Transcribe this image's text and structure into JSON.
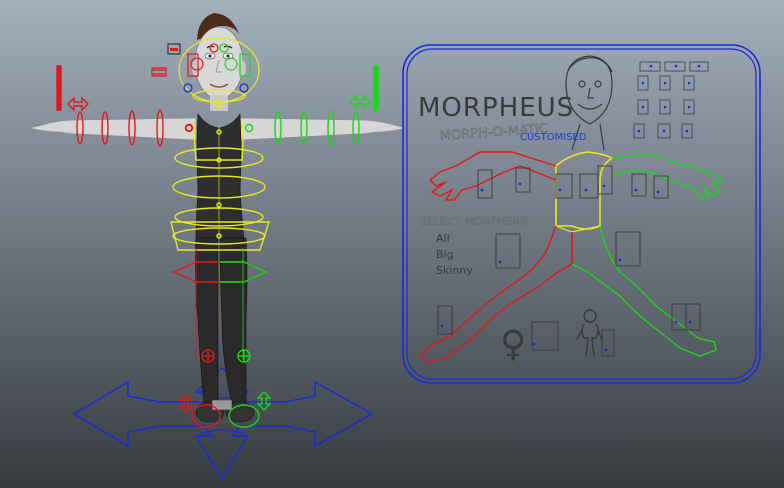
{
  "viewport": {
    "background_top": "#a3afbd",
    "background_bottom": "#373b40"
  },
  "colors": {
    "left_side_control": "#e01818",
    "right_side_control": "#18d818",
    "center_control": "#e8e820",
    "ground_control": "#1a2ad8",
    "panel_border": "#1a2ad8",
    "panel_text": "#3a3a3a",
    "customised_text": "#1a3ad8",
    "skin": "#d8d8d8",
    "body_suit": "#2e2e2e",
    "hair": "#4a2a18"
  },
  "character_rig": {
    "name": "body-rig",
    "ground_control_icon": "four-way-arrow-icon",
    "foot_switch_icons": [
      "updown-arrow-icon",
      "updown-arrow-icon"
    ]
  },
  "morph_panel": {
    "title": "MORPHEUS",
    "subtitle": "MORPH-O-MATIC",
    "tagline": "CUSTOMISED",
    "select_morphers_label": "SELECT MORPHERS",
    "morpher_options": [
      "All",
      "Big",
      "Skinny"
    ],
    "female_symbol": "♀",
    "icons": [
      "face-caricature-icon",
      "female-symbol-icon",
      "male-silhouette-icon"
    ]
  }
}
